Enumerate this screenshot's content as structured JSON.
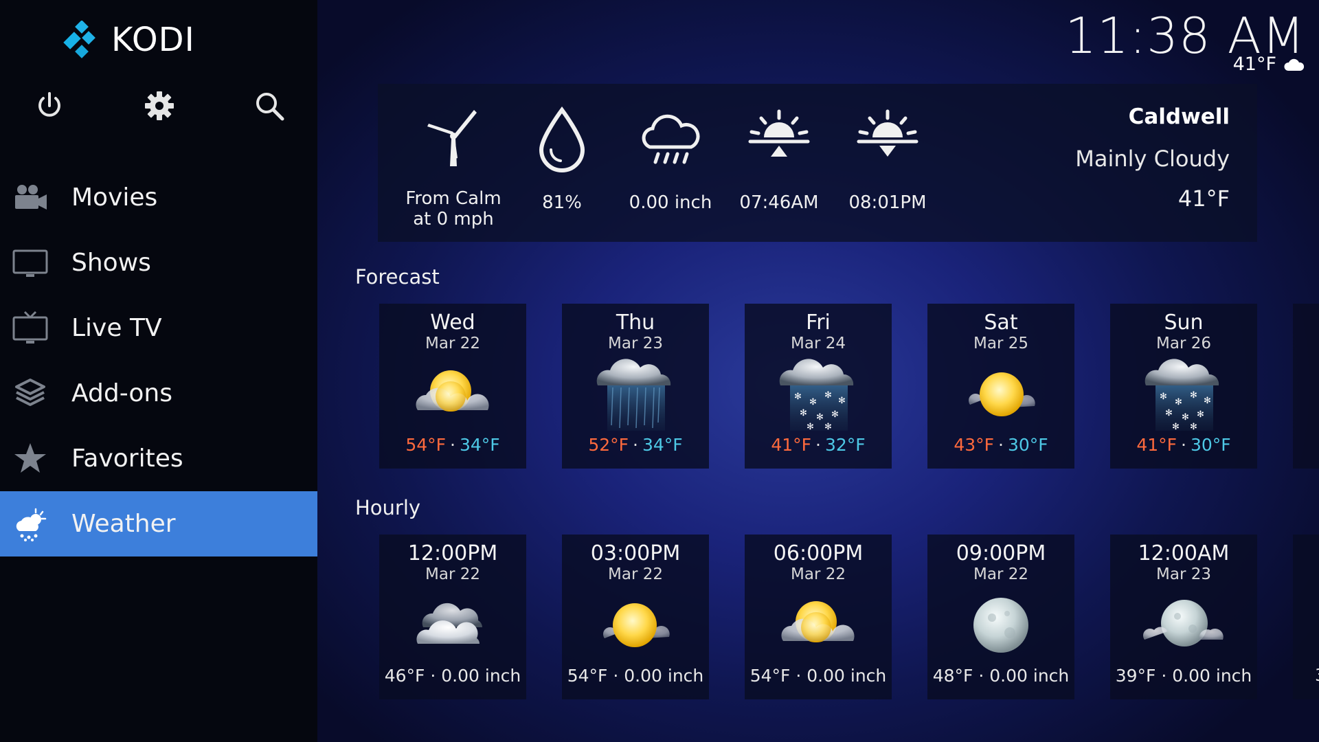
{
  "app": {
    "name": "KODI"
  },
  "toolbar": {
    "power": "power-icon",
    "settings": "gear-icon",
    "search": "search-icon"
  },
  "sidebar": {
    "items": [
      {
        "label": "Movies",
        "icon": "movie-camera-icon",
        "active": false
      },
      {
        "label": "Shows",
        "icon": "tv-icon",
        "active": false
      },
      {
        "label": "Live TV",
        "icon": "live-tv-icon",
        "active": false
      },
      {
        "label": "Add-ons",
        "icon": "addons-box-icon",
        "active": false
      },
      {
        "label": "Favorites",
        "icon": "star-icon",
        "active": false
      },
      {
        "label": "Weather",
        "icon": "weather-icon",
        "active": true
      }
    ]
  },
  "clock": {
    "time": "11:38 AM",
    "temp": "41°F",
    "icon": "cloud-icon"
  },
  "current": {
    "wind": "From Calm at 0 mph",
    "humidity": "81%",
    "precipitation": "0.00 inch",
    "sunrise": "07:46AM",
    "sunset": "08:01PM",
    "location": "Caldwell",
    "condition": "Mainly Cloudy",
    "temperature": "41°F"
  },
  "forecast": {
    "title": "Forecast",
    "days": [
      {
        "day": "Wed",
        "date": "Mar 22",
        "high": "54°F",
        "low": "34°F",
        "icon": "partly-sunny-icon"
      },
      {
        "day": "Thu",
        "date": "Mar 23",
        "high": "52°F",
        "low": "34°F",
        "icon": "rain-icon"
      },
      {
        "day": "Fri",
        "date": "Mar 24",
        "high": "41°F",
        "low": "32°F",
        "icon": "snow-icon"
      },
      {
        "day": "Sat",
        "date": "Mar 25",
        "high": "43°F",
        "low": "30°F",
        "icon": "sun-icon"
      },
      {
        "day": "Sun",
        "date": "Mar 26",
        "high": "41°F",
        "low": "30°F",
        "icon": "snow-icon"
      }
    ]
  },
  "hourly": {
    "title": "Hourly",
    "hours": [
      {
        "time": "12:00PM",
        "date": "Mar 22",
        "summary": "46°F · 0.00 inch",
        "icon": "cloudy-icon"
      },
      {
        "time": "03:00PM",
        "date": "Mar 22",
        "summary": "54°F · 0.00 inch",
        "icon": "sun-icon"
      },
      {
        "time": "06:00PM",
        "date": "Mar 22",
        "summary": "54°F · 0.00 inch",
        "icon": "partly-sunny-icon"
      },
      {
        "time": "09:00PM",
        "date": "Mar 22",
        "summary": "48°F · 0.00 inch",
        "icon": "moon-icon"
      },
      {
        "time": "12:00AM",
        "date": "Mar 23",
        "summary": "39°F · 0.00 inch",
        "icon": "moon-cloudy-icon"
      },
      {
        "summary": "3"
      }
    ]
  },
  "colors": {
    "accent": "#3d7fdb",
    "high": "#ff6a3d",
    "low": "#4ec9e6",
    "sidebar": "#05070f"
  }
}
